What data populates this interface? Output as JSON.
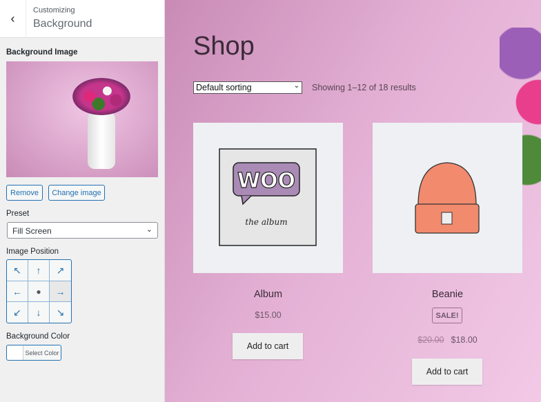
{
  "panel": {
    "customizing": "Customizing",
    "title": "Background",
    "bg_image_label": "Background Image",
    "remove": "Remove",
    "change": "Change image",
    "preset_label": "Preset",
    "preset_value": "Fill Screen",
    "position_label": "Image Position",
    "position_grid": [
      "↖",
      "↑",
      "↗",
      "←",
      "●",
      "→",
      "↙",
      "↓",
      "↘"
    ],
    "color_label": "Background Color",
    "select_color": "Select Color"
  },
  "preview": {
    "title": "Shop",
    "sorting": "Default sorting",
    "results": "Showing 1–12 of 18 results",
    "products": [
      {
        "name": "Album",
        "price": "$15.00",
        "cart": "Add to cart",
        "image_text": [
          "WOO",
          "the album"
        ]
      },
      {
        "name": "Beanie",
        "badge": "SALE!",
        "old_price": "$20.00",
        "price": "$18.00",
        "cart": "Add to cart"
      }
    ]
  },
  "colors": {
    "accent": "#2271b1",
    "preview_bg": "#e3b0d4"
  }
}
